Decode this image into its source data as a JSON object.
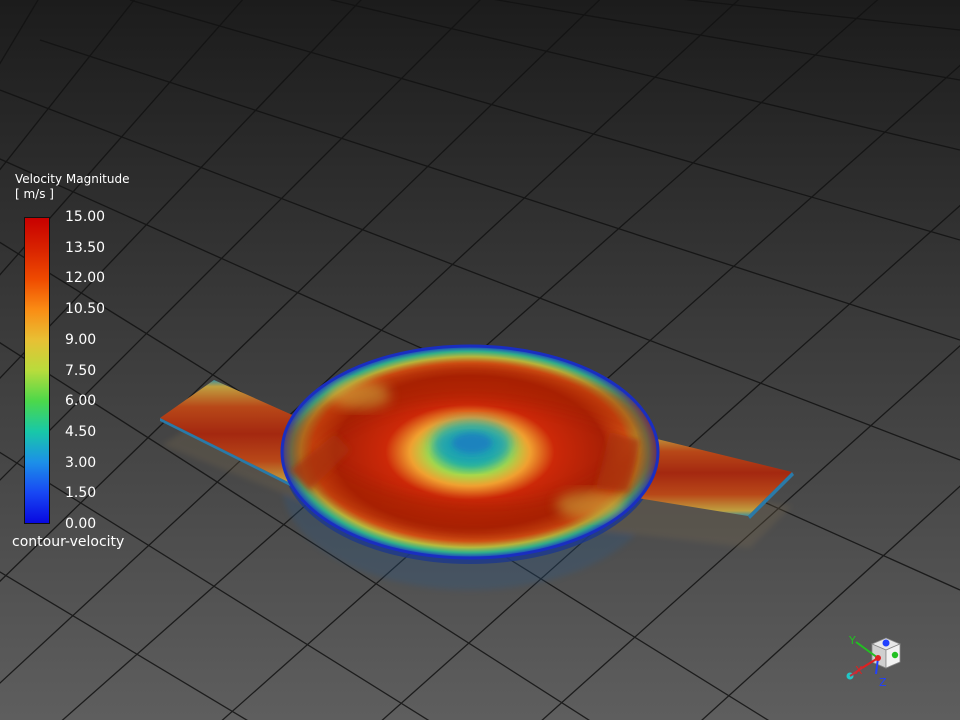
{
  "legend": {
    "title": "Velocity Magnitude",
    "unit": "[ m/s ]",
    "name": "contour-velocity",
    "min": 0.0,
    "max": 15.0,
    "ticks": [
      "15.00",
      "13.50",
      "12.00",
      "10.50",
      "9.00",
      "7.50",
      "6.00",
      "4.50",
      "3.00",
      "1.50",
      "0.00"
    ],
    "colors": [
      "#d40000",
      "#e83a00",
      "#f97a10",
      "#e8b83a",
      "#c9d840",
      "#6fdc3a",
      "#22d07a",
      "#14b4c8",
      "#2878e6",
      "#1638f0",
      "#0a0adc"
    ]
  },
  "axis_triad": {
    "labels": {
      "x": "X",
      "y": "Y",
      "z": "Z"
    },
    "colors": {
      "x": "#e02020",
      "y": "#22c022",
      "z": "#2040ff"
    }
  },
  "scene": {
    "background_top": "#1f1f1f",
    "background_bottom": "#5a5a5a",
    "grid_color": "#101010"
  }
}
